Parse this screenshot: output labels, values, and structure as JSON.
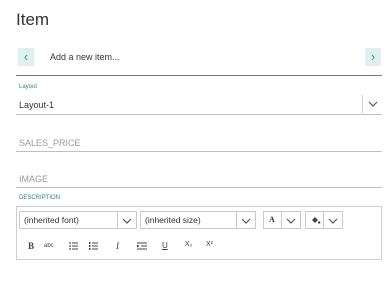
{
  "title": "Item",
  "navigator": {
    "new_item": "Add a new item...",
    "prev_icon": "chevron-left-icon",
    "next_icon": "chevron-right-icon"
  },
  "layout": {
    "label": "Layout",
    "value": "Layout-1"
  },
  "fields": {
    "sales_price": "SALES_PRICE",
    "image": "IMAGE"
  },
  "description": {
    "label": "DESCRIPTION",
    "font_value": "(inherited font)",
    "size_value": "(inherited size)",
    "text_color_glyph": "A",
    "toolbar": {
      "bold": "B",
      "strike": "abc",
      "italic": "I",
      "underline": "U",
      "subscript": "X₂",
      "superscript": "X²"
    }
  },
  "colors": {
    "accent": "#2a8c7d",
    "nav_bg": "#dff1ee"
  }
}
